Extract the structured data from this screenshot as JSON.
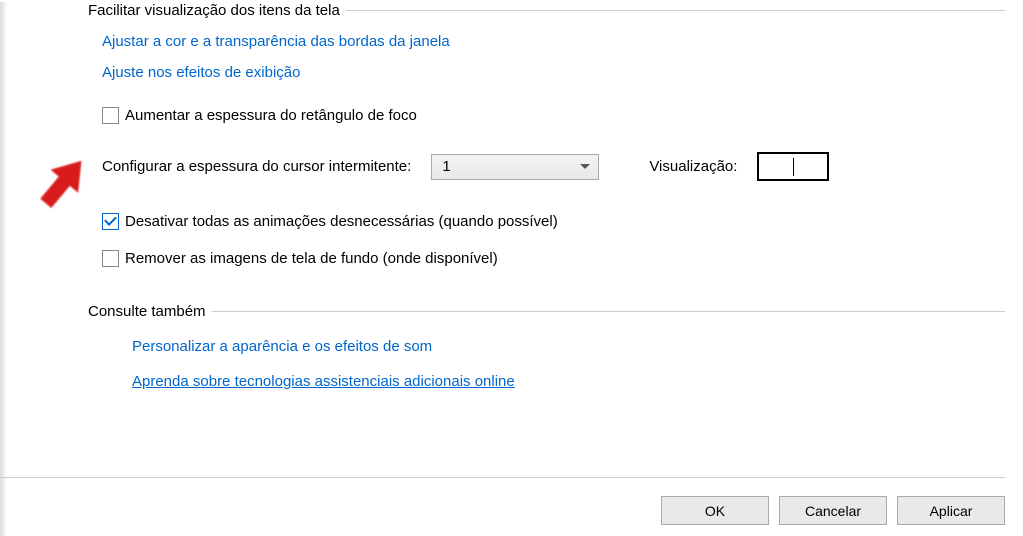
{
  "group1": {
    "legend": "Facilitar visualização dos itens da tela",
    "link1": "Ajustar a cor e a transparência das bordas da janela",
    "link2": "Ajuste nos efeitos de exibição",
    "check1": {
      "checked": false,
      "label": "Aumentar a espessura do retângulo de foco"
    },
    "cursor_label": "Configurar a espessura do cursor intermitente:",
    "cursor_value": "1",
    "preview_label": "Visualização:",
    "check2": {
      "checked": true,
      "label": "Desativar todas as animações desnecessárias (quando possível)"
    },
    "check3": {
      "checked": false,
      "label": "Remover as imagens de tela de fundo (onde disponível)"
    }
  },
  "group2": {
    "legend": "Consulte também",
    "link1": "Personalizar a aparência e os efeitos de som",
    "link2": "Aprenda sobre tecnologias assistenciais adicionais online"
  },
  "buttons": {
    "ok": "OK",
    "cancel": "Cancelar",
    "apply": "Aplicar"
  }
}
